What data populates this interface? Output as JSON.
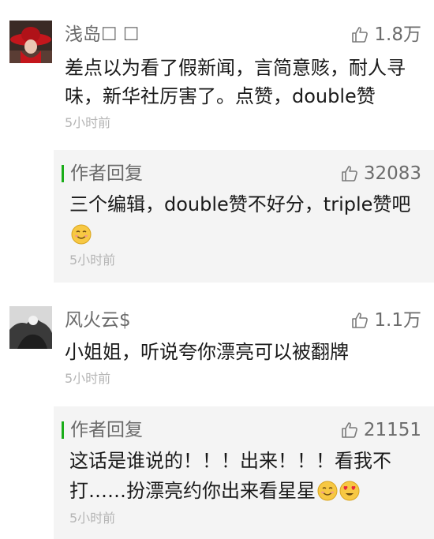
{
  "comments": [
    {
      "nickname": "浅岛☐ ☐",
      "likes": "1.8万",
      "text": "差点以为看了假新闻，言简意赅，耐人寻味，新华社厉害了。点赞，double赞",
      "time": "5小时前",
      "reply": {
        "label": "作者回复",
        "likes": "32083",
        "text": "三个编辑，double赞不好分，triple赞吧",
        "time": "5小时前"
      }
    },
    {
      "nickname": "风火云$",
      "likes": "1.1万",
      "text": "小姐姐，听说夸你漂亮可以被翻牌",
      "time": "5小时前",
      "reply": {
        "label": "作者回复",
        "likes": "21151",
        "text": "这话是谁说的！！！出来！！！看我不打……扮漂亮约你出来看星星",
        "time": "5小时前"
      }
    }
  ],
  "icons": {
    "like": "thumbs-up-icon",
    "emoji_smile": "smile-emoji",
    "emoji_love": "heart-eyes-emoji"
  },
  "colors": {
    "reply_bar": "#1aad19",
    "reply_bg": "#f4f4f4",
    "meta_text": "#6b6b6b",
    "time_text": "#b5b5b5"
  }
}
